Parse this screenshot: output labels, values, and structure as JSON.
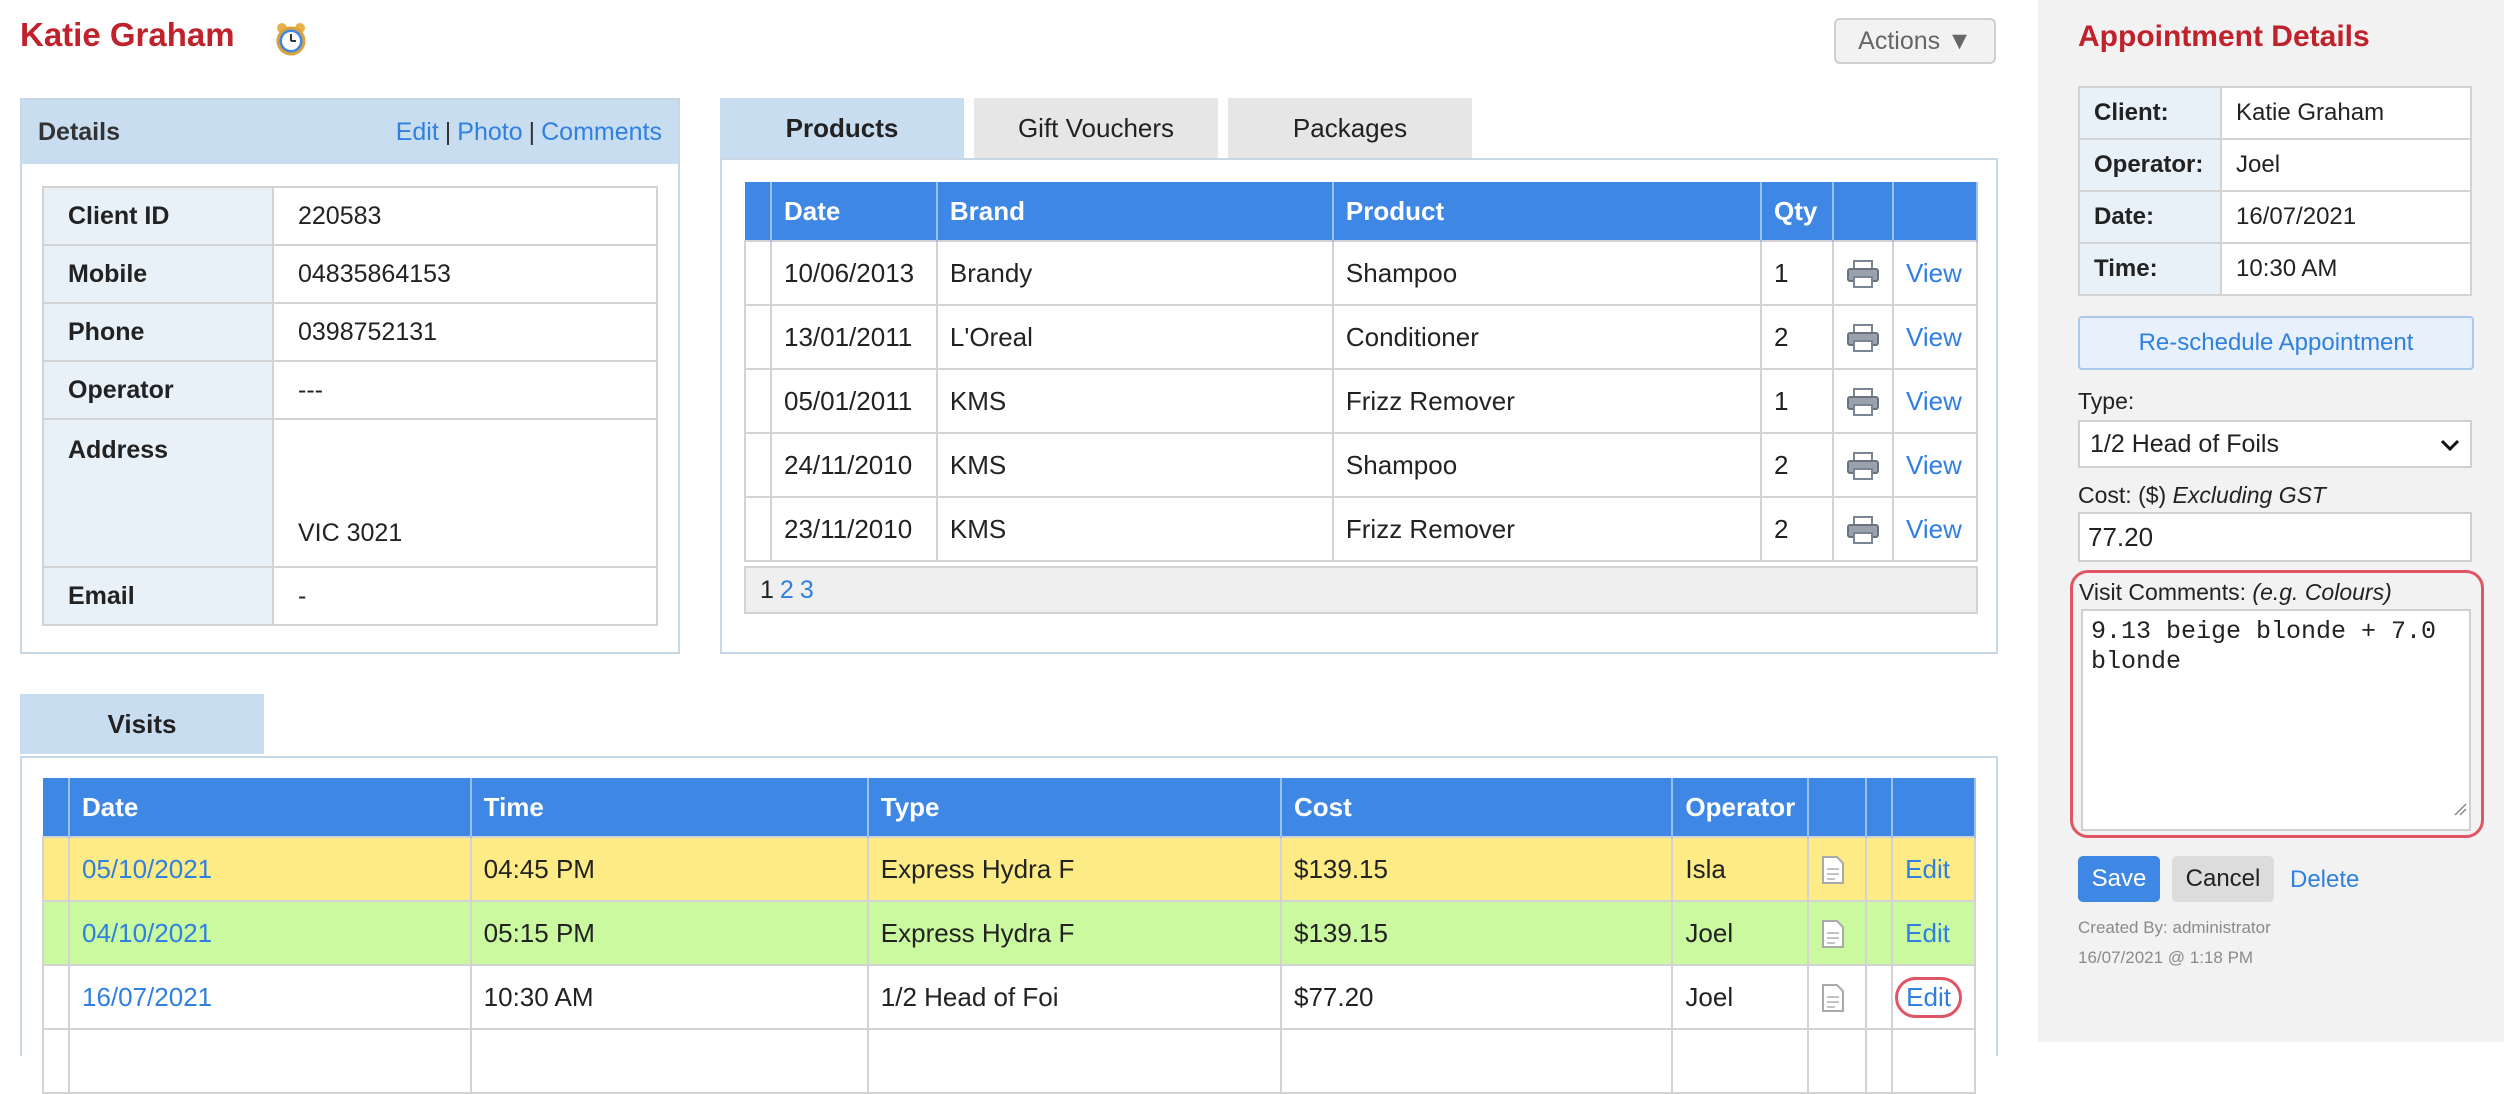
{
  "header": {
    "client_name": "Katie Graham",
    "actions_label": "Actions ▼"
  },
  "details": {
    "title": "Details",
    "links": [
      "Edit",
      "Photo",
      "Comments"
    ],
    "rows": [
      {
        "label": "Client ID",
        "value": "220583"
      },
      {
        "label": "Mobile",
        "value": "04835864153"
      },
      {
        "label": "Phone",
        "value": "0398752131"
      },
      {
        "label": "Operator",
        "value": "---"
      },
      {
        "label": "Address",
        "value": "VIC 3021"
      },
      {
        "label": "Email",
        "value": "-"
      }
    ]
  },
  "product_tabs": [
    "Products",
    "Gift Vouchers",
    "Packages"
  ],
  "products": {
    "columns": [
      "Date",
      "Brand",
      "Product",
      "Qty",
      "",
      ""
    ],
    "rows": [
      {
        "date": "10/06/2013",
        "brand": "Brandy",
        "product": "Shampoo",
        "qty": "1",
        "action": "View"
      },
      {
        "date": "13/01/2011",
        "brand": "L'Oreal",
        "product": "Conditioner",
        "qty": "2",
        "action": "View"
      },
      {
        "date": "05/01/2011",
        "brand": "KMS",
        "product": "Frizz Remover",
        "qty": "1",
        "action": "View"
      },
      {
        "date": "24/11/2010",
        "brand": "KMS",
        "product": "Shampoo",
        "qty": "2",
        "action": "View"
      },
      {
        "date": "23/11/2010",
        "brand": "KMS",
        "product": "Frizz Remover",
        "qty": "2",
        "action": "View"
      }
    ],
    "pages": [
      "1",
      "2",
      "3"
    ],
    "current_page": "1"
  },
  "visits": {
    "tab_label": "Visits",
    "columns": [
      "Date",
      "Time",
      "Type",
      "Cost",
      "Operator",
      "",
      "",
      ""
    ],
    "rows": [
      {
        "date": "05/10/2021",
        "time": "04:45 PM",
        "type": "Express Hydra F",
        "cost": "$139.15",
        "operator": "Isla",
        "action": "Edit",
        "color": "#fdeb85"
      },
      {
        "date": "04/10/2021",
        "time": "05:15 PM",
        "type": "Express Hydra F",
        "cost": "$139.15",
        "operator": "Joel",
        "action": "Edit",
        "color": "#caf99f"
      },
      {
        "date": "16/07/2021",
        "time": "10:30 AM",
        "type": "1/2 Head of Foi",
        "cost": "$77.20",
        "operator": "Joel",
        "action": "Edit",
        "color": "#ffffff"
      }
    ]
  },
  "appointment": {
    "title": "Appointment Details",
    "rows": [
      {
        "label": "Client:",
        "value": "Katie Graham"
      },
      {
        "label": "Operator:",
        "value": "Joel"
      },
      {
        "label": "Date:",
        "value": "16/07/2021"
      },
      {
        "label": "Time:",
        "value": "10:30 AM"
      }
    ],
    "reschedule_label": "Re-schedule Appointment",
    "type_label": "Type:",
    "type_value": "1/2 Head of Foils",
    "cost_label": "Cost: ($)",
    "cost_note": "Excluding GST",
    "cost_value": "77.20",
    "comments_label": "Visit Comments:",
    "comments_note": "(e.g. Colours)",
    "comments_value": "9.13 beige blonde + 7.0\nblonde",
    "save_label": "Save",
    "cancel_label": "Cancel",
    "delete_label": "Delete",
    "created_by": "Created By: administrator",
    "created_at": "16/07/2021 @ 1:18 PM"
  },
  "colors": {
    "brand_red": "#c0222c",
    "accent_blue": "#3f87e5",
    "link_blue": "#2f80e0",
    "highlight_ring": "#e05564"
  }
}
